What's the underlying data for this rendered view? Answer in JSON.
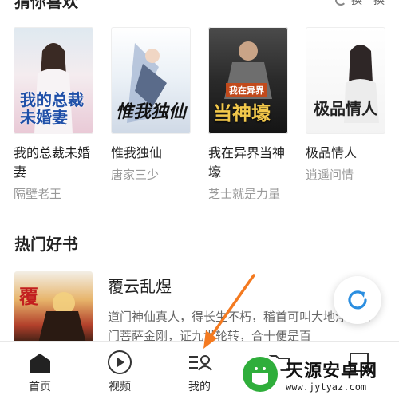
{
  "header": {
    "title": "猜你喜欢",
    "action_label": "换一换"
  },
  "recommended_books": [
    {
      "title": "我的总裁未婚妻",
      "author": "隔壁老王",
      "cover_text": "我的总裁未婚妻"
    },
    {
      "title": "惟我独仙",
      "author": "唐家三少",
      "cover_text": "惟我独仙"
    },
    {
      "title": "我在异界当神壕",
      "author": "芝士就是力量",
      "cover_text": "当神壕",
      "cover_tag": "我在异界"
    },
    {
      "title": "极品情人",
      "author": "逍遥问情",
      "cover_text": "极品情人"
    }
  ],
  "hot_section": {
    "title": "热门好书",
    "book": {
      "title": "覆云乱煜",
      "description": "道门神仙真人，得长生不朽，稽首可叫大地浮，佛门菩萨金刚，证九世轮转，合十便是百"
    }
  },
  "tabbar": {
    "tabs": [
      {
        "label": "首页"
      },
      {
        "label": "视频"
      },
      {
        "label": "我的"
      }
    ]
  },
  "watermark": {
    "name": "天源安卓网",
    "url": "www.jytyaz.com"
  },
  "colors": {
    "accent_blue": "#2b8ee0",
    "arrow_orange": "#f47a20",
    "text_primary": "#222222",
    "text_secondary": "#999999"
  }
}
